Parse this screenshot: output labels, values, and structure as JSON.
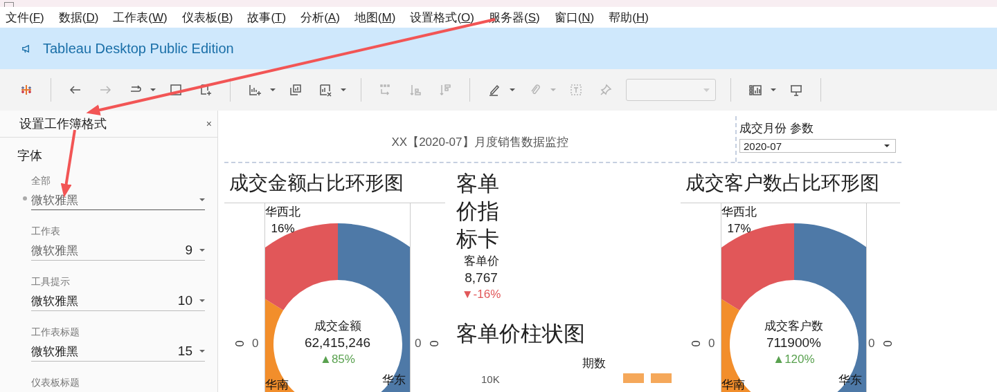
{
  "menu": [
    {
      "before": "文件(",
      "key": "F",
      "after": ")"
    },
    {
      "before": "数据(",
      "key": "D",
      "after": ")"
    },
    {
      "before": "工作表(",
      "key": "W",
      "after": ")"
    },
    {
      "before": "仪表板(",
      "key": "B",
      "after": ")"
    },
    {
      "before": "故事(",
      "key": "T",
      "after": ")"
    },
    {
      "before": "分析(",
      "key": "A",
      "after": ")"
    },
    {
      "before": "地图(",
      "key": "M",
      "after": ")"
    },
    {
      "before": "设置格式(",
      "key": "O",
      "after": ")"
    },
    {
      "before": "服务器(",
      "key": "S",
      "after": ")"
    },
    {
      "before": "窗口(",
      "key": "N",
      "after": ")"
    },
    {
      "before": "帮助(",
      "key": "H",
      "after": ")"
    }
  ],
  "banner": {
    "title": "Tableau Desktop Public Edition"
  },
  "toolbar": [
    {
      "kind": "logo",
      "disabled": false,
      "caret": false
    },
    {
      "kind": "separator"
    },
    {
      "kind": "back",
      "disabled": false,
      "caret": false
    },
    {
      "kind": "forward",
      "disabled": true,
      "caret": false
    },
    {
      "kind": "redo",
      "disabled": false,
      "caret": true
    },
    {
      "kind": "blank-sheet",
      "disabled": false,
      "caret": false
    },
    {
      "kind": "new-sheet",
      "disabled": false,
      "caret": false
    },
    {
      "kind": "separator"
    },
    {
      "kind": "new-chart",
      "disabled": false,
      "caret": true
    },
    {
      "kind": "duplicate",
      "disabled": false,
      "caret": false
    },
    {
      "kind": "clear",
      "disabled": false,
      "caret": true
    },
    {
      "kind": "separator"
    },
    {
      "kind": "swap",
      "disabled": true,
      "caret": false
    },
    {
      "kind": "sort-asc",
      "disabled": true,
      "caret": false
    },
    {
      "kind": "sort-desc",
      "disabled": true,
      "caret": false
    },
    {
      "kind": "separator"
    },
    {
      "kind": "highlight",
      "disabled": false,
      "caret": true
    },
    {
      "kind": "attach",
      "disabled": true,
      "caret": true
    },
    {
      "kind": "text",
      "disabled": true,
      "caret": false
    },
    {
      "kind": "pin",
      "disabled": true,
      "caret": false
    },
    {
      "kind": "select",
      "disabled": true,
      "caret": false
    },
    {
      "kind": "separator"
    },
    {
      "kind": "show-me",
      "disabled": false,
      "caret": true
    },
    {
      "kind": "present",
      "disabled": false,
      "caret": false
    },
    {
      "kind": "separator"
    }
  ],
  "format_panel": {
    "title": "设置工作簿格式",
    "close": "×",
    "section": "字体",
    "fields": [
      {
        "label": "全部",
        "font": "微软雅黑",
        "dimmed": true,
        "marked": true
      },
      {
        "label": "工作表",
        "font": "微软雅黑",
        "size": "9",
        "dimmed": true,
        "marked": false
      },
      {
        "label": "工具提示",
        "font": "微软雅黑",
        "size": "10",
        "dimmed": false,
        "marked": false
      },
      {
        "label": "工作表标题",
        "font": "微软雅黑",
        "size": "15",
        "dimmed": false,
        "marked": false
      },
      {
        "label": "仪表板标题"
      }
    ]
  },
  "dashboard": {
    "title": "XX【2020-07】月度销售数据监控",
    "parameter": {
      "label": "成交月份 参数",
      "value": "2020-07"
    },
    "donuts": [
      {
        "title": "成交金额占比环形图",
        "axis_labels": [
          "0",
          "0",
          "0",
          "0"
        ],
        "center": {
          "label": "成交金额",
          "value": "62,415,246",
          "change": "▲85%",
          "increase": true
        },
        "slice_labels": [
          {
            "region": "华西北",
            "share": "16%"
          },
          {
            "region": "华南"
          },
          {
            "region": "华东"
          }
        ]
      },
      {
        "title": "成交客户数占比环形图",
        "axis_labels": [
          "0",
          "0",
          "0",
          "0"
        ],
        "center": {
          "label": "成交客户数",
          "value": "711900%",
          "change": "▲120%",
          "increase": true
        },
        "slice_labels": [
          {
            "region": "华西北",
            "share": "17%"
          },
          {
            "region": "华南"
          },
          {
            "region": "华东"
          }
        ]
      }
    ],
    "kpi_card": {
      "title": "客单价指标卡",
      "label": "客单价",
      "value": "8,767",
      "change": "▼-16%",
      "increase": false
    },
    "bar_chart": {
      "title": "客单价柱状图",
      "column_header": "期数",
      "axis_tick": "10K"
    }
  }
}
